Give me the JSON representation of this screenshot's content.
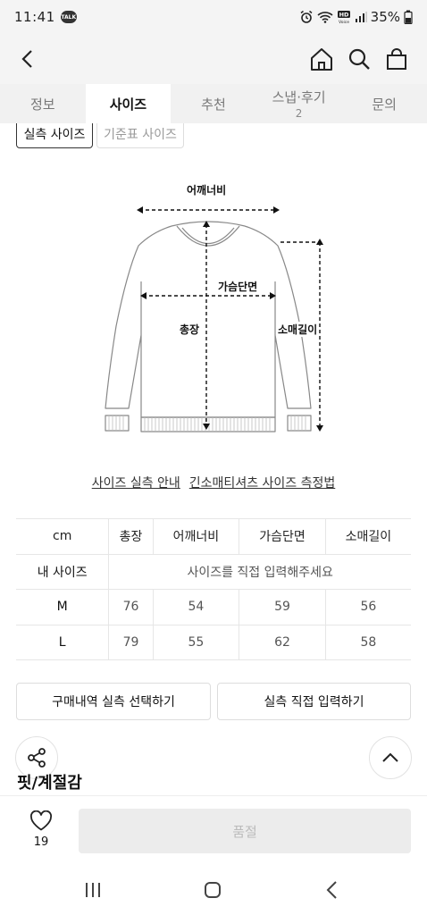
{
  "status_bar": {
    "time": "11:41",
    "talk_badge": "TALK",
    "battery": "35%"
  },
  "tabs": [
    {
      "label": "정보",
      "sub": ""
    },
    {
      "label": "사이즈",
      "sub": ""
    },
    {
      "label": "추천",
      "sub": ""
    },
    {
      "label": "스냅·후기",
      "sub": "2"
    },
    {
      "label": "문의",
      "sub": ""
    }
  ],
  "size_type_chips": {
    "measured": "실측 사이즈",
    "standard": "기준표 사이즈"
  },
  "diagram": {
    "shoulder": "어깨너비",
    "chest": "가슴단면",
    "length": "총장",
    "sleeve": "소매길이"
  },
  "links": {
    "guide": "사이즈 실측 안내",
    "howto": "긴소매티셔츠 사이즈 측정법"
  },
  "size_table": {
    "headers": [
      "cm",
      "총장",
      "어깨너비",
      "가슴단면",
      "소매길이"
    ],
    "my_size_label": "내 사이즈",
    "my_size_placeholder": "사이즈를 직접 입력해주세요",
    "rows": [
      {
        "size": "M",
        "values": [
          "76",
          "54",
          "59",
          "56"
        ]
      },
      {
        "size": "L",
        "values": [
          "79",
          "55",
          "62",
          "58"
        ]
      }
    ]
  },
  "buttons": {
    "select_purchase": "구매내역 실측 선택하기",
    "input_direct": "실측 직접 입력하기"
  },
  "section_title": "핏/계절감",
  "bottom": {
    "like_count": "19",
    "soldout_label": "품절"
  }
}
